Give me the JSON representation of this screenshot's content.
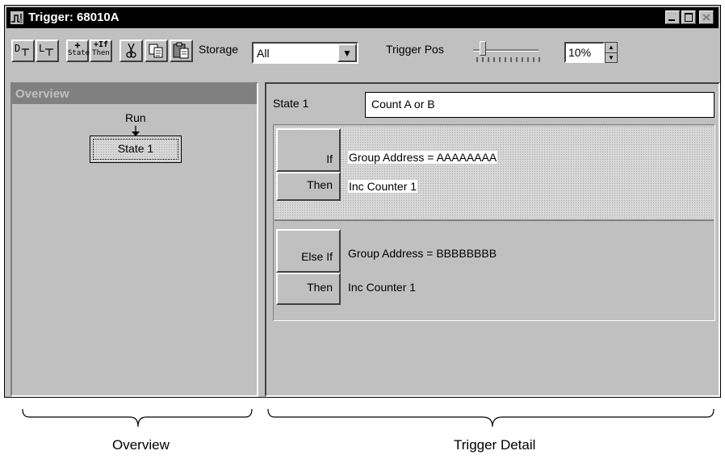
{
  "window": {
    "title": "Trigger: 68010A"
  },
  "toolbar": {
    "state_label": "Storage",
    "storage_value": "All",
    "trigger_pos_label": "Trigger Pos",
    "trigger_pos_value": "10%",
    "tool_plus": "+",
    "tool_state": "State",
    "tool_plus_if": "+If",
    "tool_then": "Then"
  },
  "overview": {
    "header": "Overview",
    "run_label": "Run",
    "state_box": "State 1"
  },
  "detail": {
    "state_label": "State 1",
    "state_name": "Count A or B",
    "clauses": [
      {
        "if_label": "If",
        "if_value": "Group Address = AAAAAAAA",
        "then_label": "Then",
        "then_value": "Inc Counter 1"
      },
      {
        "if_label": "Else If",
        "if_value": "Group Address = BBBBBBBB",
        "then_label": "Then",
        "then_value": "Inc Counter 1"
      }
    ]
  },
  "captions": {
    "left": "Overview",
    "right": "Trigger Detail"
  }
}
